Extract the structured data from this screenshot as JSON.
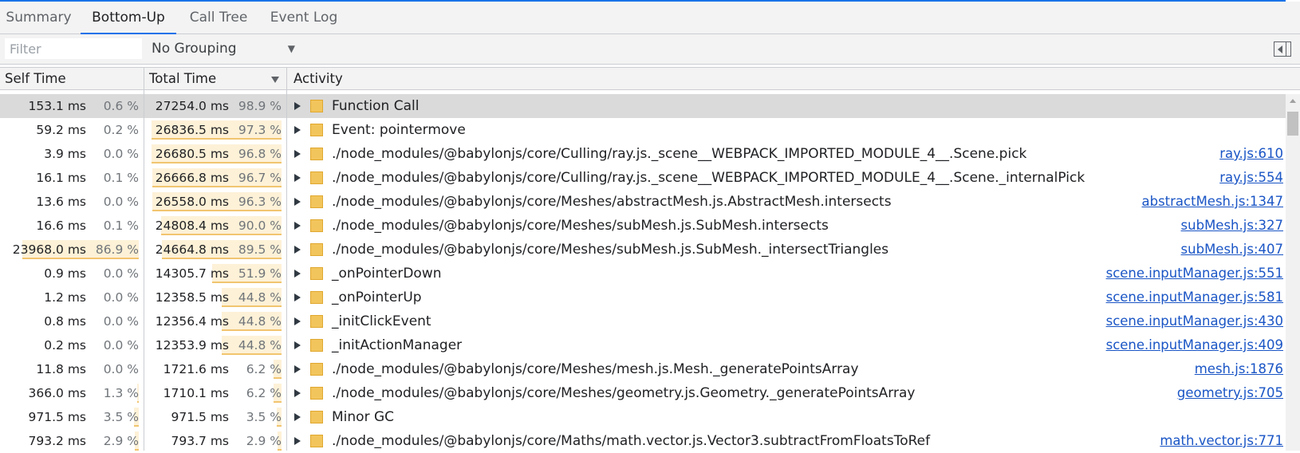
{
  "tabs": [
    {
      "label": "Summary"
    },
    {
      "label": "Bottom-Up",
      "active": true
    },
    {
      "label": "Call Tree"
    },
    {
      "label": "Event Log"
    }
  ],
  "toolbar": {
    "filter_placeholder": "Filter",
    "grouping_value": "No Grouping"
  },
  "columns": {
    "self_time": "Self Time",
    "total_time": "Total Time",
    "activity": "Activity"
  },
  "colors": {
    "activity_swatch": "#f2c55c",
    "bar_fill": "#fdf1d7",
    "bar_edge": "#f1c56f",
    "link": "#1a55c5",
    "tab_accent": "#1a73e8"
  },
  "rows": [
    {
      "self_ms": "153.1 ms",
      "self_pct": "0.6 %",
      "self_frac": 0.006,
      "total_ms": "27254.0 ms",
      "total_pct": "98.9 %",
      "total_frac": 0.989,
      "activity": "Function Call",
      "source": "",
      "selected": true
    },
    {
      "self_ms": "59.2 ms",
      "self_pct": "0.2 %",
      "self_frac": 0.002,
      "total_ms": "26836.5 ms",
      "total_pct": "97.3 %",
      "total_frac": 0.973,
      "activity": "Event: pointermove",
      "source": ""
    },
    {
      "self_ms": "3.9 ms",
      "self_pct": "0.0 %",
      "self_frac": 0.0,
      "total_ms": "26680.5 ms",
      "total_pct": "96.8 %",
      "total_frac": 0.968,
      "activity": "./node_modules/@babylonjs/core/Culling/ray.js._scene__WEBPACK_IMPORTED_MODULE_4__.Scene.pick",
      "source": "ray.js:610"
    },
    {
      "self_ms": "16.1 ms",
      "self_pct": "0.1 %",
      "self_frac": 0.001,
      "total_ms": "26666.8 ms",
      "total_pct": "96.7 %",
      "total_frac": 0.967,
      "activity": "./node_modules/@babylonjs/core/Culling/ray.js._scene__WEBPACK_IMPORTED_MODULE_4__.Scene._internalPick",
      "source": "ray.js:554"
    },
    {
      "self_ms": "13.6 ms",
      "self_pct": "0.0 %",
      "self_frac": 0.0,
      "total_ms": "26558.0 ms",
      "total_pct": "96.3 %",
      "total_frac": 0.963,
      "activity": "./node_modules/@babylonjs/core/Meshes/abstractMesh.js.AbstractMesh.intersects",
      "source": "abstractMesh.js:1347"
    },
    {
      "self_ms": "16.6 ms",
      "self_pct": "0.1 %",
      "self_frac": 0.001,
      "total_ms": "24808.4 ms",
      "total_pct": "90.0 %",
      "total_frac": 0.9,
      "activity": "./node_modules/@babylonjs/core/Meshes/subMesh.js.SubMesh.intersects",
      "source": "subMesh.js:327"
    },
    {
      "self_ms": "23968.0 ms",
      "self_pct": "86.9 %",
      "self_frac": 0.869,
      "total_ms": "24664.8 ms",
      "total_pct": "89.5 %",
      "total_frac": 0.895,
      "activity": "./node_modules/@babylonjs/core/Meshes/subMesh.js.SubMesh._intersectTriangles",
      "source": "subMesh.js:407"
    },
    {
      "self_ms": "0.9 ms",
      "self_pct": "0.0 %",
      "self_frac": 0.0,
      "total_ms": "14305.7 ms",
      "total_pct": "51.9 %",
      "total_frac": 0.519,
      "activity": "_onPointerDown",
      "source": "scene.inputManager.js:551"
    },
    {
      "self_ms": "1.2 ms",
      "self_pct": "0.0 %",
      "self_frac": 0.0,
      "total_ms": "12358.5 ms",
      "total_pct": "44.8 %",
      "total_frac": 0.448,
      "activity": "_onPointerUp",
      "source": "scene.inputManager.js:581"
    },
    {
      "self_ms": "0.8 ms",
      "self_pct": "0.0 %",
      "self_frac": 0.0,
      "total_ms": "12356.4 ms",
      "total_pct": "44.8 %",
      "total_frac": 0.448,
      "activity": "_initClickEvent",
      "source": "scene.inputManager.js:430"
    },
    {
      "self_ms": "0.2 ms",
      "self_pct": "0.0 %",
      "self_frac": 0.0,
      "total_ms": "12353.9 ms",
      "total_pct": "44.8 %",
      "total_frac": 0.448,
      "activity": "_initActionManager",
      "source": "scene.inputManager.js:409"
    },
    {
      "self_ms": "11.8 ms",
      "self_pct": "0.0 %",
      "self_frac": 0.0,
      "total_ms": "1721.6 ms",
      "total_pct": "6.2 %",
      "total_frac": 0.062,
      "activity": "./node_modules/@babylonjs/core/Meshes/mesh.js.Mesh._generatePointsArray",
      "source": "mesh.js:1876"
    },
    {
      "self_ms": "366.0 ms",
      "self_pct": "1.3 %",
      "self_frac": 0.013,
      "total_ms": "1710.1 ms",
      "total_pct": "6.2 %",
      "total_frac": 0.062,
      "activity": "./node_modules/@babylonjs/core/Meshes/geometry.js.Geometry._generatePointsArray",
      "source": "geometry.js:705"
    },
    {
      "self_ms": "971.5 ms",
      "self_pct": "3.5 %",
      "self_frac": 0.035,
      "total_ms": "971.5 ms",
      "total_pct": "3.5 %",
      "total_frac": 0.035,
      "activity": "Minor GC",
      "source": ""
    },
    {
      "self_ms": "793.2 ms",
      "self_pct": "2.9 %",
      "self_frac": 0.029,
      "total_ms": "793.7 ms",
      "total_pct": "2.9 %",
      "total_frac": 0.029,
      "activity": "./node_modules/@babylonjs/core/Maths/math.vector.js.Vector3.subtractFromFloatsToRef",
      "source": "math.vector.js:771"
    }
  ]
}
